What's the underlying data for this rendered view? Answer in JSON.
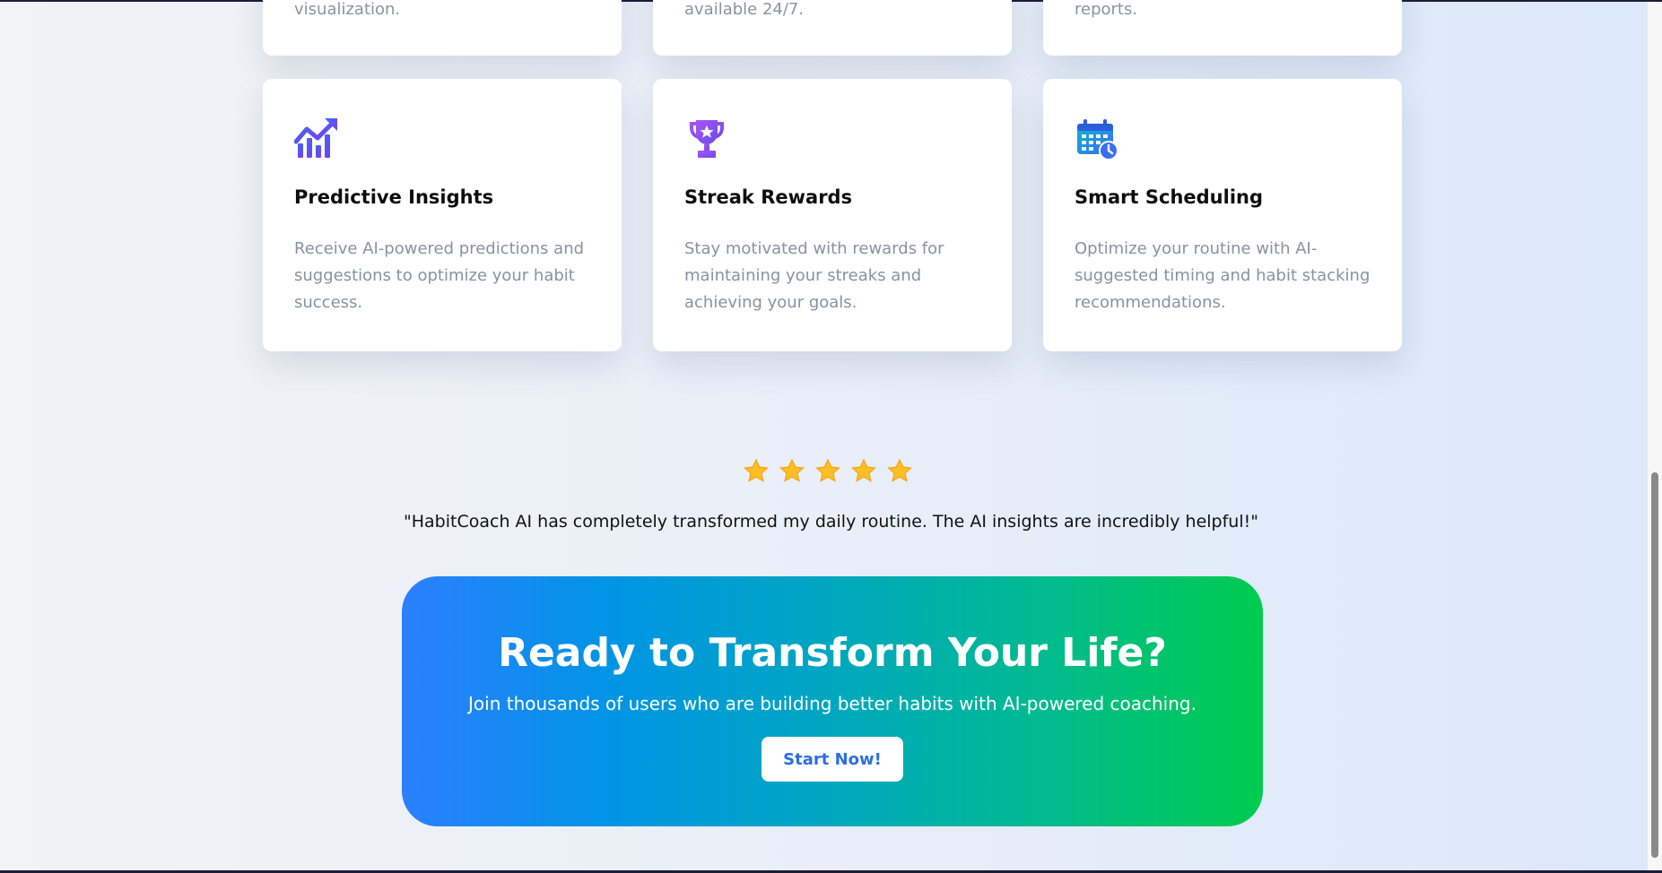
{
  "top_cards": [
    {
      "tail_text": "visualization."
    },
    {
      "tail_text": "available 24/7."
    },
    {
      "tail_text": "reports."
    }
  ],
  "features": [
    {
      "icon": "trending-up-chart-icon",
      "title": "Predictive Insights",
      "description": "Receive AI-powered predictions and suggestions to optimize your habit success."
    },
    {
      "icon": "trophy-icon",
      "title": "Streak Rewards",
      "description": "Stay motivated with rewards for maintaining your streaks and achieving your goals."
    },
    {
      "icon": "calendar-clock-icon",
      "title": "Smart Scheduling",
      "description": "Optimize your routine with AI-suggested timing and habit stacking recommendations."
    }
  ],
  "testimonial": {
    "rating": 5,
    "quote": "\"HabitCoach AI has completely transformed my daily routine. The AI insights are incredibly helpful!\""
  },
  "cta": {
    "title": "Ready to Transform Your Life?",
    "subtitle": "Join thousands of users who are building better habits with AI-powered coaching.",
    "button_label": "Start Now!"
  },
  "colors": {
    "cta_gradient_start": "#2b7fff",
    "cta_gradient_end": "#00cc4e",
    "star": "#fbbf24",
    "button_text": "#2b6fe0",
    "description_text": "#8a91a0"
  }
}
